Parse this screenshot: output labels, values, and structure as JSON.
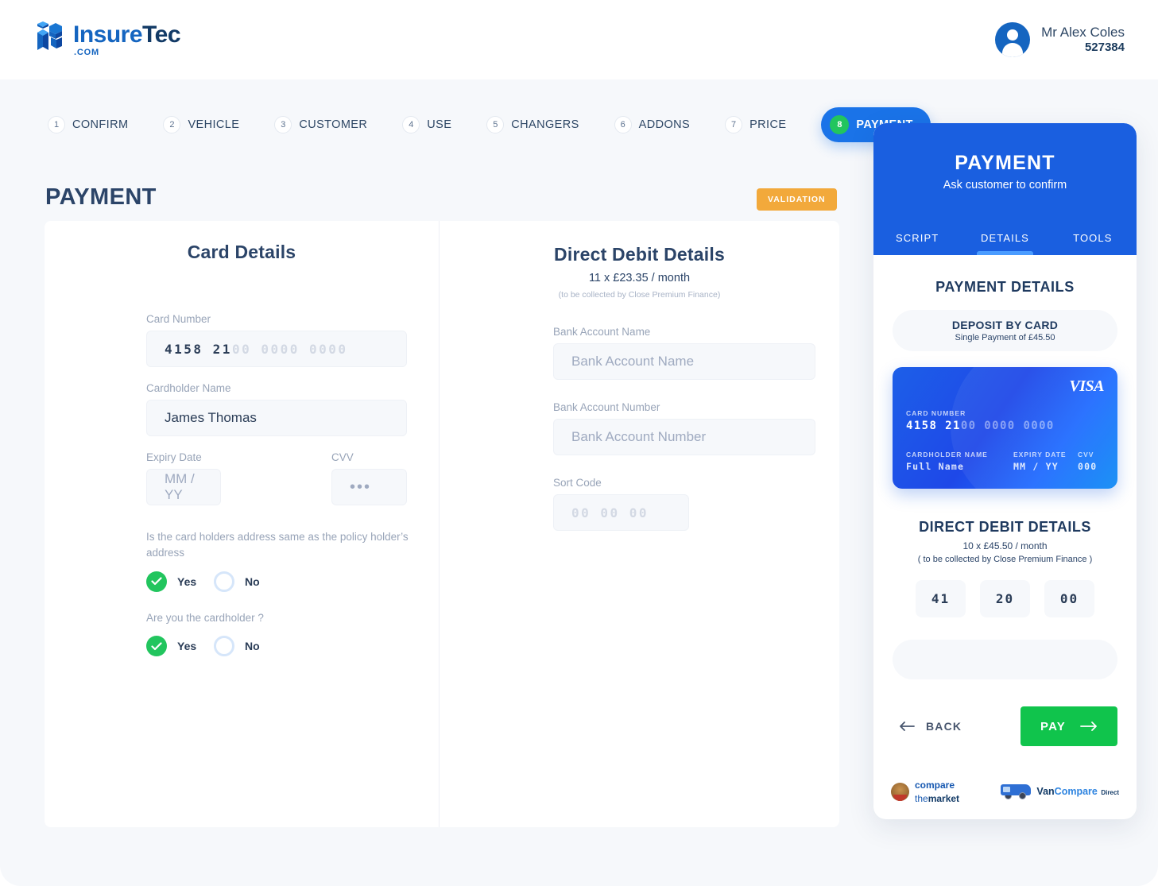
{
  "header": {
    "brand": {
      "name_part1": "Insure",
      "name_part2": "Tec",
      "dotcom": ".COM"
    },
    "user": {
      "name": "Mr Alex Coles",
      "id": "527384"
    }
  },
  "stepper": {
    "steps": [
      {
        "num": "1",
        "label": "CONFIRM",
        "active": false
      },
      {
        "num": "2",
        "label": "VEHICLE",
        "active": false
      },
      {
        "num": "3",
        "label": "CUSTOMER",
        "active": false
      },
      {
        "num": "4",
        "label": "USE",
        "active": false
      },
      {
        "num": "5",
        "label": "CHANGERS",
        "active": false
      },
      {
        "num": "6",
        "label": "ADDONS",
        "active": false
      },
      {
        "num": "7",
        "label": "PRICE",
        "active": false
      },
      {
        "num": "8",
        "label": "PAYMENT",
        "active": true
      }
    ]
  },
  "page": {
    "title": "PAYMENT",
    "validation_label": "VALIDATION"
  },
  "card_details": {
    "heading": "Card Details",
    "card_number": {
      "label": "Card Number",
      "entered": "4158 21",
      "remaining": "00  0000  0000"
    },
    "cardholder_name": {
      "label": "Cardholder Name",
      "value": "James Thomas"
    },
    "expiry": {
      "label": "Expiry Date",
      "placeholder": "MM / YY"
    },
    "cvv": {
      "label": "CVV",
      "placeholder": "•••"
    },
    "question_address": {
      "text": "Is the card holders address same as the policy holder’s address",
      "yes_label": "Yes",
      "no_label": "No",
      "selected": "Yes"
    },
    "question_cardholder": {
      "text": "Are you the cardholder ?",
      "yes_label": "Yes",
      "no_label": "No",
      "selected": "Yes"
    }
  },
  "direct_debit": {
    "heading": "Direct Debit Details",
    "schedule": "11 x £23.35 / month",
    "note": "(to be collected by Close Premium Finance)",
    "bank_account_name": {
      "label": "Bank Account Name",
      "placeholder": "Bank Account Name"
    },
    "bank_account_number": {
      "label": "Bank Account Number",
      "placeholder": "Bank Account Number"
    },
    "sort_code": {
      "label": "Sort Code",
      "placeholder": "00  00  00"
    }
  },
  "panel": {
    "title": "PAYMENT",
    "subtitle": "Ask customer to confirm",
    "tabs": [
      {
        "label": "SCRIPT",
        "active": false
      },
      {
        "label": "DETAILS",
        "active": true
      },
      {
        "label": "TOOLS",
        "active": false
      }
    ],
    "payment_details_title": "PAYMENT DETAILS",
    "deposit": {
      "title": "DEPOSIT BY CARD",
      "subtitle": "Single Payment of £45.50"
    },
    "credit_card": {
      "brand": "VISA",
      "card_number_label": "CARD NUMBER",
      "card_number_entered": "4158 21",
      "card_number_remaining": "00  0000  0000",
      "cardholder_label": "CARDHOLDER NAME",
      "cardholder_value": "Full Name",
      "expiry_label": "EXPIRY DATE",
      "expiry_value": "MM / YY",
      "cvv_label": "CVV",
      "cvv_value": "000"
    },
    "direct_debit": {
      "title": "DIRECT DEBIT DETAILS",
      "schedule": "10 x £45.50 / month",
      "note": "( to be collected by Close Premium Finance )",
      "sort_boxes": [
        "41",
        "20",
        "00"
      ]
    },
    "back_label": "BACK",
    "pay_label": "PAY",
    "footer": {
      "ctm_line1": "compare",
      "ctm_line2_a": "the",
      "ctm_line2_b": "market",
      "vc_van": "Van",
      "vc_compare": "Compare",
      "vc_direct": "Direct"
    }
  },
  "colors": {
    "brand_blue": "#1565C0",
    "accent_blue": "#1A73E8",
    "panel_blue": "#1A5FE0",
    "green": "#22C55E",
    "pay_green": "#10C44C",
    "orange": "#F2A93B",
    "navy": "#2B4468",
    "muted": "#98A4B8",
    "bg": "#F6F8FB"
  }
}
